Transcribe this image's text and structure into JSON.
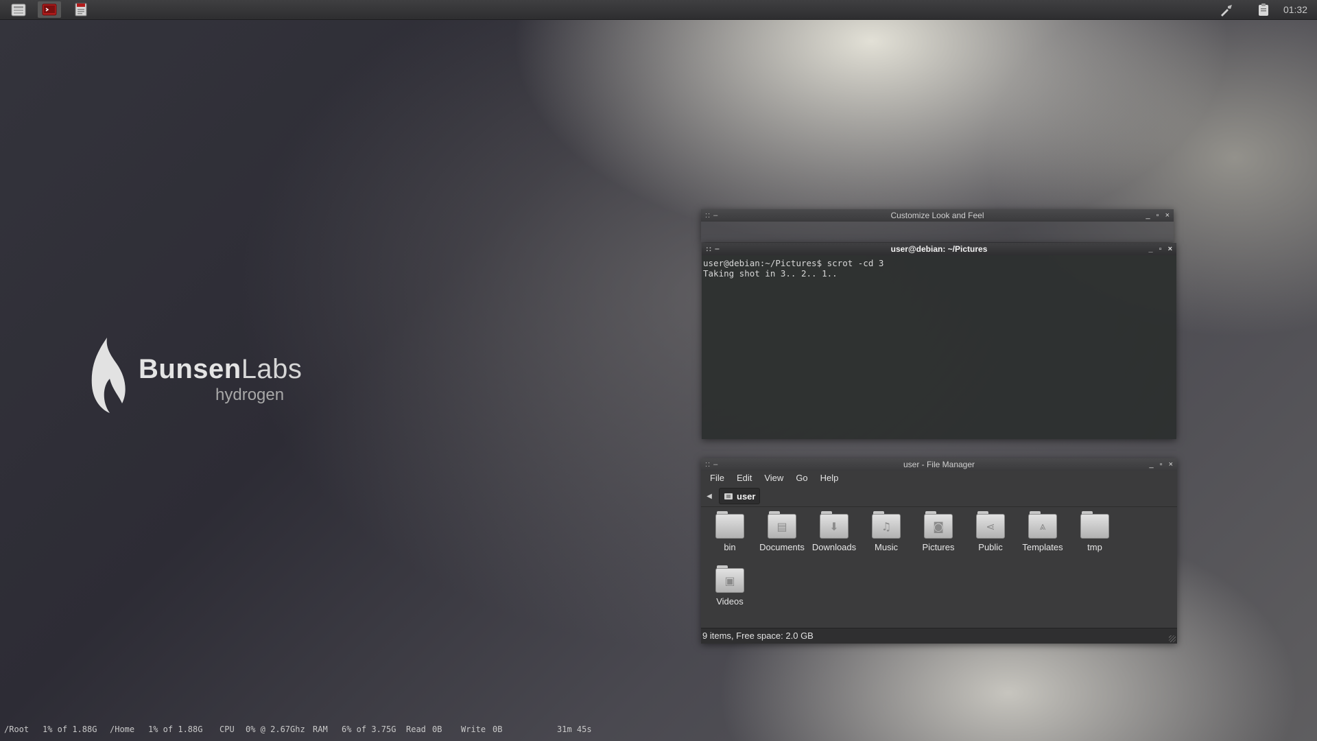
{
  "desktop": {
    "logo": {
      "brand_bold": "Bunsen",
      "brand_light": "Labs",
      "subtitle": "hydrogen"
    }
  },
  "top_panel": {
    "launchers": [
      {
        "name": "file-manager-icon"
      },
      {
        "name": "terminal-icon"
      },
      {
        "name": "text-editor-icon"
      }
    ],
    "clock": "01:32"
  },
  "windows": {
    "customize": {
      "title": "Customize Look and Feel",
      "buttons": {
        "minimize": "_",
        "maximize": "▫",
        "close": "×"
      }
    },
    "terminal": {
      "title": "user@debian: ~/Pictures",
      "lines": [
        "user@debian:~/Pictures$ scrot -cd 3",
        "Taking shot in 3.. 2.. 1.."
      ],
      "buttons": {
        "minimize": "_",
        "maximize": "▫",
        "close": "×"
      }
    },
    "file_manager": {
      "title": "user - File Manager",
      "menu": [
        "File",
        "Edit",
        "View",
        "Go",
        "Help"
      ],
      "path": "user",
      "items": [
        "bin",
        "Documents",
        "Downloads",
        "Music",
        "Pictures",
        "Public",
        "Templates",
        "tmp",
        "Videos"
      ],
      "status": "9 items, Free space: 2.0 GB",
      "buttons": {
        "minimize": "_",
        "maximize": "▫",
        "close": "×"
      }
    }
  },
  "conky": {
    "root_label": "/Root",
    "root_value": "1% of 1.88G",
    "home_label": "/Home",
    "home_value": "1% of 1.88G",
    "cpu_label": "CPU",
    "cpu_value": "0% @ 2.67Ghz",
    "ram_label": "RAM",
    "ram_value": "6% of 3.75G",
    "read_label": "Read",
    "read_value": "0B",
    "write_label": "Write",
    "write_value": "0B",
    "uptime": "31m 45s"
  }
}
